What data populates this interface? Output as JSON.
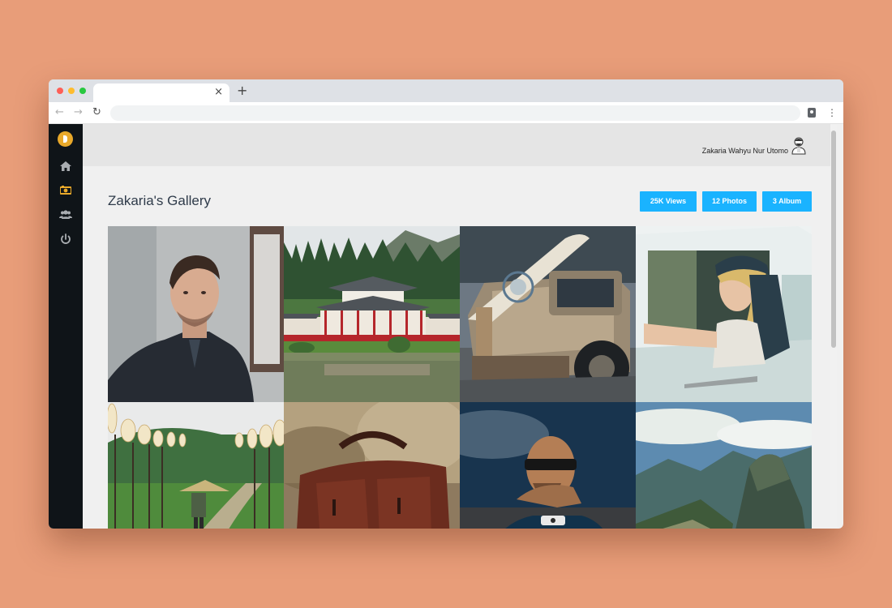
{
  "browser": {
    "tab_title": "",
    "tab_close": "×",
    "new_tab": "+",
    "back": "←",
    "forward": "→",
    "reload": "↻",
    "address": "",
    "menu": "⋮"
  },
  "sidebar": {
    "logo": "app-logo",
    "items": [
      {
        "name": "home",
        "icon": "home-icon"
      },
      {
        "name": "gallery",
        "icon": "camera-icon",
        "active": true
      },
      {
        "name": "users",
        "icon": "users-icon"
      },
      {
        "name": "logout",
        "icon": "power-icon"
      }
    ],
    "active_color": "#e9a92a"
  },
  "header": {
    "user_name": "Zakaria Wahyu Nur Utomo",
    "avatar_icon": "user-avatar"
  },
  "gallery": {
    "title": "Zakaria's Gallery",
    "stats": {
      "views": "25K Views",
      "photos": "12 Photos",
      "albums": "3 Album"
    },
    "accent": "#1ab3ff",
    "photos": [
      {
        "subject": "portrait-man"
      },
      {
        "subject": "japanese-temple"
      },
      {
        "subject": "vintage-truck-surfboard"
      },
      {
        "subject": "woman-in-car"
      },
      {
        "subject": "lantern-path"
      },
      {
        "subject": "leather-bag"
      },
      {
        "subject": "man-with-sunglasses"
      },
      {
        "subject": "mountain-ruins"
      }
    ]
  }
}
